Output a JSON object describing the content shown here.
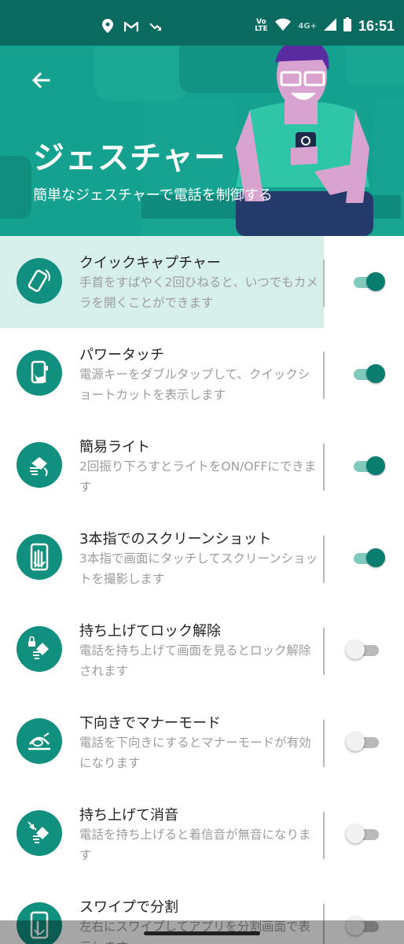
{
  "status_bar": {
    "time": "16:51",
    "volte_label": "Vo LTE",
    "network_label": "4G+",
    "icons": [
      "location-icon",
      "gmail-icon",
      "missed-call-icon",
      "wifi-icon",
      "signal-icon",
      "battery-icon"
    ]
  },
  "header": {
    "title": "ジェスチャー",
    "subtitle": "簡単なジェスチャーで電話を制御する",
    "bg_color": "#14a18f"
  },
  "items": [
    {
      "title": "クイックキャプチャー",
      "desc": "手首をすばやく2回ひねると、いつでもカメラを開くことができます",
      "enabled": true,
      "icon": "phone-twist-icon",
      "highlighted": true
    },
    {
      "title": "パワータッチ",
      "desc": "電源キーをダブルタップして、クイックショートカットを表示します",
      "enabled": true,
      "icon": "power-touch-icon"
    },
    {
      "title": "簡易ライト",
      "desc": "2回振り下ろすとライトをON/OFFにできます",
      "enabled": true,
      "icon": "flashlight-chop-icon"
    },
    {
      "title": "3本指でのスクリーンショット",
      "desc": "3本指で画面にタッチしてスクリーンショットを撮影します",
      "enabled": true,
      "icon": "three-finger-icon"
    },
    {
      "title": "持ち上げてロック解除",
      "desc": "電話を持ち上げて画面を見るとロック解除されます",
      "enabled": false,
      "icon": "lift-unlock-icon"
    },
    {
      "title": "下向きでマナーモード",
      "desc": "電話を下向きにするとマナーモードが有効になります",
      "enabled": false,
      "icon": "flip-silent-icon"
    },
    {
      "title": "持ち上げて消音",
      "desc": "電話を持ち上げると着信音が無音になります",
      "enabled": false,
      "icon": "lift-mute-icon"
    },
    {
      "title": "スワイプで分割",
      "desc": "左右にスワイプしてアプリを分割画面で表示します",
      "enabled": false,
      "icon": "swipe-split-icon"
    }
  ],
  "colors": {
    "accent": "#0a7d6e",
    "status_bar": "#0b6b61",
    "highlight": "#d7efeb"
  }
}
